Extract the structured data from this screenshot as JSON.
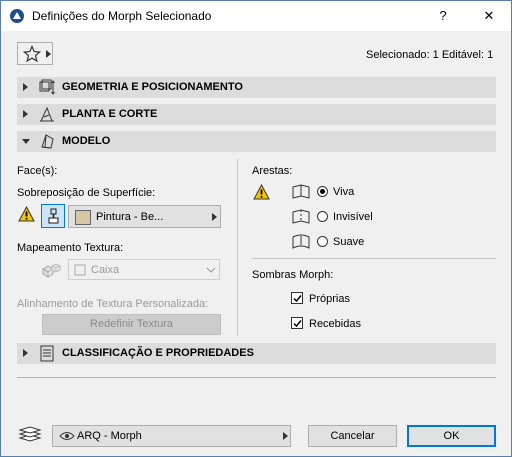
{
  "window": {
    "title": "Definições do Morph Selecionado",
    "help_label": "?",
    "close_label": "✕"
  },
  "header": {
    "favorites_icon": "star-icon",
    "selection_status": "Selecionado: 1 Editável: 1"
  },
  "sections": {
    "geometry": "GEOMETRIA E POSICIONAMENTO",
    "plan": "PLANTA E CORTE",
    "model": "MODELO",
    "classification": "CLASSIFICAÇÃO E PROPRIEDADES"
  },
  "model": {
    "faces_label": "Face(s):",
    "surface_override_label": "Sobreposição de Superfície:",
    "surface_value": "Pintura - Be...",
    "texture_mapping_label": "Mapeamento Textura:",
    "texture_mapping_value": "Caixa",
    "custom_texture_label": "Alinhamento de Textura Personalizada:",
    "reset_texture_button": "Redefinir Textura",
    "edges_label": "Arestas:",
    "edge_options": [
      "Viva",
      "Invisível",
      "Suave"
    ],
    "edge_selected": "Viva",
    "shadows_label": "Sombras Morph:",
    "shadow_own": "Próprias",
    "shadow_received": "Recebidas",
    "shadow_own_checked": true,
    "shadow_received_checked": true,
    "surface_swatch_color": "#d6c6a6"
  },
  "footer": {
    "layer_value": "ARQ - Morph",
    "cancel_button": "Cancelar",
    "ok_button": "OK"
  },
  "colors": {
    "accent": "#0078d7",
    "warning": "#f5c400",
    "section_bg": "#dcdcdc"
  }
}
